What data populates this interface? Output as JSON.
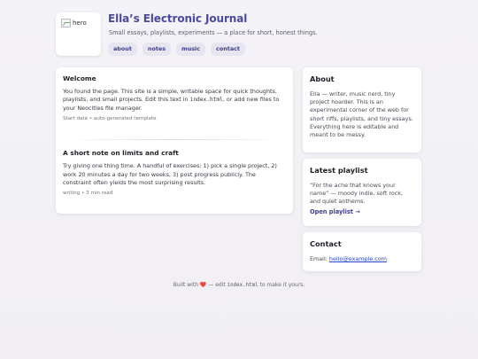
{
  "hero": {
    "alt": "hero"
  },
  "header": {
    "title": "Ella’s Electronic Journal",
    "tagline": "Small essays, playlists, experiments — a place for short, honest things."
  },
  "nav": [
    "about",
    "notes",
    "music",
    "contact"
  ],
  "posts": [
    {
      "title": "Welcome",
      "body_parts": [
        "You found the page. This site is a simple, writable space for quick thoughts, playlists, and small projects. Edit this text in ",
        "index.html",
        ", or add new files to your Neocities file manager."
      ],
      "meta": "Start date • auto-generated template"
    },
    {
      "title": "A short note on limits and craft",
      "body": "Try giving one thing time. A handful of exercises: 1) pick a single project, 2) work 20 minutes a day for two weeks, 3) post progress publicly. The constraint often yields the most surprising results.",
      "meta": "writing • 3 min read"
    }
  ],
  "about": {
    "title": "About",
    "text": "Ella — writer, music nerd, tiny project hoarder. This is an experimental corner of the web for short riffs, playlists, and tiny essays. Everything here is editable and meant to be messy."
  },
  "playlist": {
    "title": "Latest playlist",
    "quote": "“For the ache that knows your name” — moody indie, soft rock, and quiet anthems.",
    "link": "Open playlist →"
  },
  "contact": {
    "title": "Contact",
    "label": "Email: ",
    "email": "hello@example.com"
  },
  "footer": {
    "before": "Built with ",
    "heart": "❤️",
    "middle": " — edit ",
    "code": "index.html",
    "after": " to make it yours."
  },
  "colors": {
    "accent": "#4a4aa0",
    "link": "#2846c8",
    "heart": "#d63a3a"
  }
}
